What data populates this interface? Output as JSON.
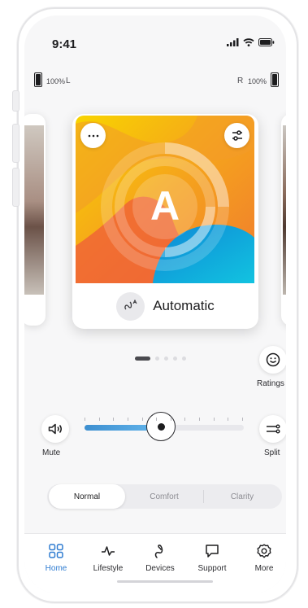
{
  "status": {
    "time": "9:41",
    "icons": [
      "signal-icon",
      "wifi-icon",
      "battery-icon"
    ]
  },
  "battery": {
    "left_percent": "100%",
    "left_side": "L",
    "right_side": "R",
    "right_percent": "100%"
  },
  "program_card": {
    "label": "Automatic",
    "badge_letter": "A",
    "more_icon": "more-dots-icon",
    "adjust_icon": "sliders-icon",
    "program_icon": "hearing-aid-icon"
  },
  "pagination": {
    "count": 5,
    "active": 0
  },
  "actions": {
    "ratings_label": "Ratings",
    "mute_label": "Mute",
    "split_label": "Split"
  },
  "volume": {
    "level": 0.48,
    "ticks": 12
  },
  "sound_modes": {
    "options": [
      "Normal",
      "Comfort",
      "Clarity"
    ],
    "selected": "Normal"
  },
  "tabs": [
    {
      "label": "Home",
      "icon": "grid-icon",
      "active": true
    },
    {
      "label": "Lifestyle",
      "icon": "activity-icon",
      "active": false
    },
    {
      "label": "Devices",
      "icon": "hearing-aid-icon",
      "active": false
    },
    {
      "label": "Support",
      "icon": "chat-icon",
      "active": false
    },
    {
      "label": "More",
      "icon": "gear-icon",
      "active": false
    }
  ],
  "colors": {
    "accent": "#2f7cd1",
    "slider_fill": "#4a9edf",
    "art_yellow": "#f6c500",
    "art_orange": "#f28a2f",
    "art_blue": "#0fa6d8"
  }
}
